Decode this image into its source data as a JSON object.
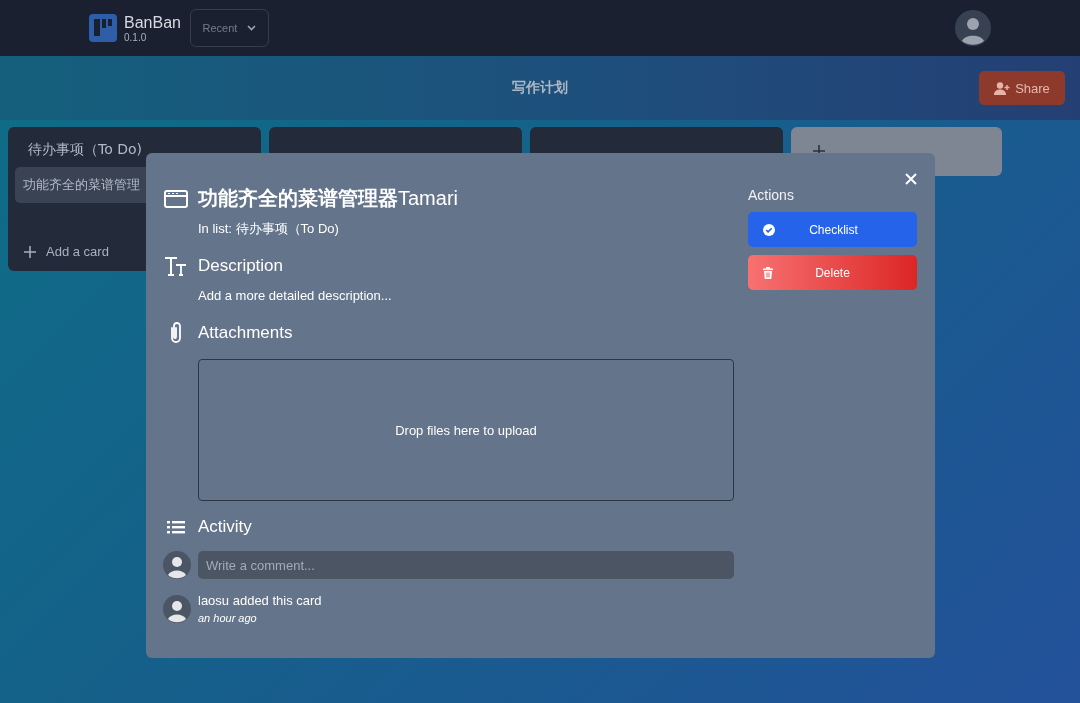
{
  "app": {
    "name": "BanBan",
    "version": "0.1.0",
    "recent_label": "Recent"
  },
  "board": {
    "title": "写作计划",
    "share_label": "Share"
  },
  "lists": [
    {
      "kind": "list",
      "title": "待办事项（To Do)",
      "cards": [
        "功能齐全的菜谱管理"
      ],
      "add_card_label": "Add a card"
    },
    {
      "kind": "covered"
    },
    {
      "kind": "covered"
    }
  ],
  "modal": {
    "title_bold": "功能齐全的菜谱管理器",
    "title_rest": "Tamari",
    "in_list": "In list: 待办事项（To Do)",
    "description_heading": "Description",
    "description_placeholder": "Add a more detailed description...",
    "attachments_heading": "Attachments",
    "dropzone_text": "Drop files here to upload",
    "activity_heading": "Activity",
    "comment_placeholder": "Write a comment...",
    "activity": [
      {
        "text": "laosu added this card",
        "time": "an hour ago"
      }
    ],
    "actions_heading": "Actions",
    "actions": [
      {
        "kind": "checklist",
        "label": "Checklist"
      },
      {
        "kind": "delete",
        "label": "Delete"
      }
    ]
  }
}
